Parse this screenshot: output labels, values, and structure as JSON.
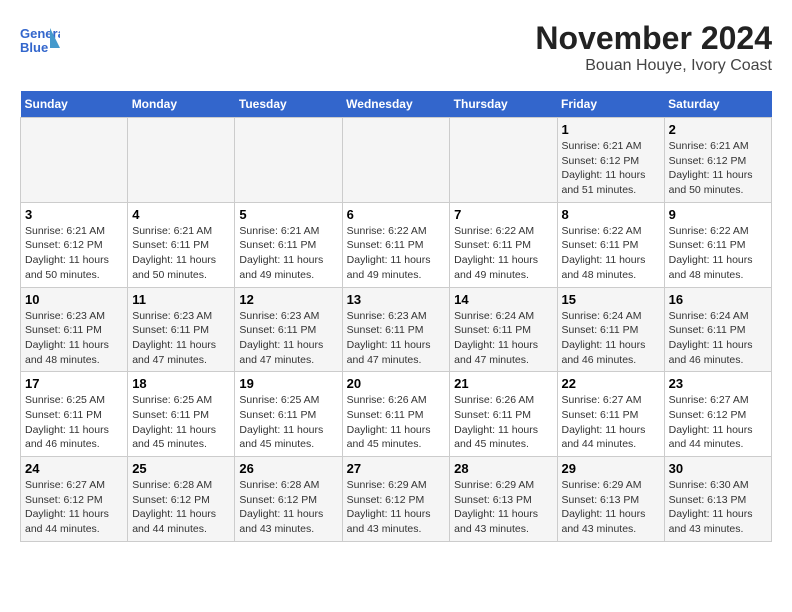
{
  "logo": {
    "line1": "General",
    "line2": "Blue"
  },
  "title": "November 2024",
  "subtitle": "Bouan Houye, Ivory Coast",
  "days_of_week": [
    "Sunday",
    "Monday",
    "Tuesday",
    "Wednesday",
    "Thursday",
    "Friday",
    "Saturday"
  ],
  "weeks": [
    [
      {
        "day": "",
        "sunrise": "",
        "sunset": "",
        "daylight": ""
      },
      {
        "day": "",
        "sunrise": "",
        "sunset": "",
        "daylight": ""
      },
      {
        "day": "",
        "sunrise": "",
        "sunset": "",
        "daylight": ""
      },
      {
        "day": "",
        "sunrise": "",
        "sunset": "",
        "daylight": ""
      },
      {
        "day": "",
        "sunrise": "",
        "sunset": "",
        "daylight": ""
      },
      {
        "day": "1",
        "sunrise": "Sunrise: 6:21 AM",
        "sunset": "Sunset: 6:12 PM",
        "daylight": "Daylight: 11 hours and 51 minutes."
      },
      {
        "day": "2",
        "sunrise": "Sunrise: 6:21 AM",
        "sunset": "Sunset: 6:12 PM",
        "daylight": "Daylight: 11 hours and 50 minutes."
      }
    ],
    [
      {
        "day": "3",
        "sunrise": "Sunrise: 6:21 AM",
        "sunset": "Sunset: 6:12 PM",
        "daylight": "Daylight: 11 hours and 50 minutes."
      },
      {
        "day": "4",
        "sunrise": "Sunrise: 6:21 AM",
        "sunset": "Sunset: 6:11 PM",
        "daylight": "Daylight: 11 hours and 50 minutes."
      },
      {
        "day": "5",
        "sunrise": "Sunrise: 6:21 AM",
        "sunset": "Sunset: 6:11 PM",
        "daylight": "Daylight: 11 hours and 49 minutes."
      },
      {
        "day": "6",
        "sunrise": "Sunrise: 6:22 AM",
        "sunset": "Sunset: 6:11 PM",
        "daylight": "Daylight: 11 hours and 49 minutes."
      },
      {
        "day": "7",
        "sunrise": "Sunrise: 6:22 AM",
        "sunset": "Sunset: 6:11 PM",
        "daylight": "Daylight: 11 hours and 49 minutes."
      },
      {
        "day": "8",
        "sunrise": "Sunrise: 6:22 AM",
        "sunset": "Sunset: 6:11 PM",
        "daylight": "Daylight: 11 hours and 48 minutes."
      },
      {
        "day": "9",
        "sunrise": "Sunrise: 6:22 AM",
        "sunset": "Sunset: 6:11 PM",
        "daylight": "Daylight: 11 hours and 48 minutes."
      }
    ],
    [
      {
        "day": "10",
        "sunrise": "Sunrise: 6:23 AM",
        "sunset": "Sunset: 6:11 PM",
        "daylight": "Daylight: 11 hours and 48 minutes."
      },
      {
        "day": "11",
        "sunrise": "Sunrise: 6:23 AM",
        "sunset": "Sunset: 6:11 PM",
        "daylight": "Daylight: 11 hours and 47 minutes."
      },
      {
        "day": "12",
        "sunrise": "Sunrise: 6:23 AM",
        "sunset": "Sunset: 6:11 PM",
        "daylight": "Daylight: 11 hours and 47 minutes."
      },
      {
        "day": "13",
        "sunrise": "Sunrise: 6:23 AM",
        "sunset": "Sunset: 6:11 PM",
        "daylight": "Daylight: 11 hours and 47 minutes."
      },
      {
        "day": "14",
        "sunrise": "Sunrise: 6:24 AM",
        "sunset": "Sunset: 6:11 PM",
        "daylight": "Daylight: 11 hours and 47 minutes."
      },
      {
        "day": "15",
        "sunrise": "Sunrise: 6:24 AM",
        "sunset": "Sunset: 6:11 PM",
        "daylight": "Daylight: 11 hours and 46 minutes."
      },
      {
        "day": "16",
        "sunrise": "Sunrise: 6:24 AM",
        "sunset": "Sunset: 6:11 PM",
        "daylight": "Daylight: 11 hours and 46 minutes."
      }
    ],
    [
      {
        "day": "17",
        "sunrise": "Sunrise: 6:25 AM",
        "sunset": "Sunset: 6:11 PM",
        "daylight": "Daylight: 11 hours and 46 minutes."
      },
      {
        "day": "18",
        "sunrise": "Sunrise: 6:25 AM",
        "sunset": "Sunset: 6:11 PM",
        "daylight": "Daylight: 11 hours and 45 minutes."
      },
      {
        "day": "19",
        "sunrise": "Sunrise: 6:25 AM",
        "sunset": "Sunset: 6:11 PM",
        "daylight": "Daylight: 11 hours and 45 minutes."
      },
      {
        "day": "20",
        "sunrise": "Sunrise: 6:26 AM",
        "sunset": "Sunset: 6:11 PM",
        "daylight": "Daylight: 11 hours and 45 minutes."
      },
      {
        "day": "21",
        "sunrise": "Sunrise: 6:26 AM",
        "sunset": "Sunset: 6:11 PM",
        "daylight": "Daylight: 11 hours and 45 minutes."
      },
      {
        "day": "22",
        "sunrise": "Sunrise: 6:27 AM",
        "sunset": "Sunset: 6:11 PM",
        "daylight": "Daylight: 11 hours and 44 minutes."
      },
      {
        "day": "23",
        "sunrise": "Sunrise: 6:27 AM",
        "sunset": "Sunset: 6:12 PM",
        "daylight": "Daylight: 11 hours and 44 minutes."
      }
    ],
    [
      {
        "day": "24",
        "sunrise": "Sunrise: 6:27 AM",
        "sunset": "Sunset: 6:12 PM",
        "daylight": "Daylight: 11 hours and 44 minutes."
      },
      {
        "day": "25",
        "sunrise": "Sunrise: 6:28 AM",
        "sunset": "Sunset: 6:12 PM",
        "daylight": "Daylight: 11 hours and 44 minutes."
      },
      {
        "day": "26",
        "sunrise": "Sunrise: 6:28 AM",
        "sunset": "Sunset: 6:12 PM",
        "daylight": "Daylight: 11 hours and 43 minutes."
      },
      {
        "day": "27",
        "sunrise": "Sunrise: 6:29 AM",
        "sunset": "Sunset: 6:12 PM",
        "daylight": "Daylight: 11 hours and 43 minutes."
      },
      {
        "day": "28",
        "sunrise": "Sunrise: 6:29 AM",
        "sunset": "Sunset: 6:13 PM",
        "daylight": "Daylight: 11 hours and 43 minutes."
      },
      {
        "day": "29",
        "sunrise": "Sunrise: 6:29 AM",
        "sunset": "Sunset: 6:13 PM",
        "daylight": "Daylight: 11 hours and 43 minutes."
      },
      {
        "day": "30",
        "sunrise": "Sunrise: 6:30 AM",
        "sunset": "Sunset: 6:13 PM",
        "daylight": "Daylight: 11 hours and 43 minutes."
      }
    ]
  ]
}
